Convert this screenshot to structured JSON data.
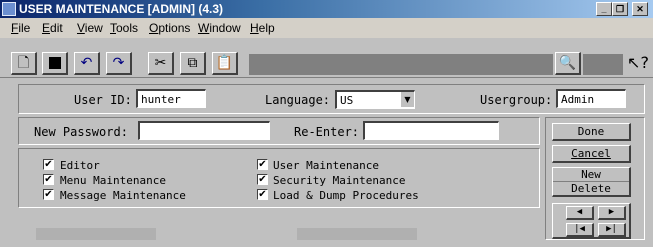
{
  "window": {
    "title": "USER MAINTENANCE [ADMIN] (4.3)",
    "controls": [
      "minimize",
      "restore",
      "close"
    ]
  },
  "menu": [
    "File",
    "Edit",
    "View",
    "Tools",
    "Options",
    "Window",
    "Help"
  ],
  "toolbar": {
    "buttons": [
      "new-document-icon",
      "save-icon",
      "undo-icon",
      "redo-icon",
      "cut-icon",
      "copy-icon",
      "paste-icon",
      "find-user-icon",
      "help-pointer-icon"
    ]
  },
  "user_fields": {
    "user_id_label": "User ID:",
    "user_id_value": "hunter",
    "language_label": "Language:",
    "language_value": "US",
    "usergroup_label": "Usergroup:",
    "usergroup_value": "Admin"
  },
  "password_fields": {
    "new_password_label": "New Password:",
    "reenter_label": "Re-Enter:"
  },
  "permissions": [
    {
      "label": "Editor",
      "checked": true
    },
    {
      "label": "Menu Maintenance",
      "checked": true
    },
    {
      "label": "Message Maintenance",
      "checked": true
    },
    {
      "label": "User Maintenance",
      "checked": true
    },
    {
      "label": "Security Maintenance",
      "checked": true
    },
    {
      "label": "Load & Dump Procedures",
      "checked": true
    }
  ],
  "actions": {
    "done": "Done",
    "cancel": "Cancel",
    "new": "New",
    "delete": "Delete"
  },
  "colors": {
    "titlebar_start": "#0a246a",
    "titlebar_end": "#a6caf0",
    "window_face": "#c0c0c0"
  }
}
